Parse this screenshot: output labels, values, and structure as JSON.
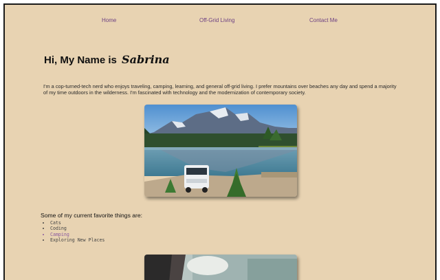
{
  "nav": {
    "home": "Home",
    "offgrid": "Off-Grid Living",
    "contact": "Contact Me"
  },
  "hero": {
    "greeting": "Hi, My Name is",
    "name": "Sabrina"
  },
  "intro": "I'm a cop-turned-tech nerd who enjoys traveling, camping, learning, and general off-grid living. I prefer mountains over beaches any day and spend a majority of my time outdoors in the wilderness. I'm fascinated with technology and the modernization of contemporary society.",
  "favorites": {
    "title": "Some of my current favorite things are:",
    "items": [
      "Cats",
      "Coding",
      "Camping",
      "Exploring New Places"
    ]
  },
  "colors": {
    "background": "#e8d3b2",
    "nav_link": "#6b3f82",
    "list_link": "#8a5aa0"
  }
}
